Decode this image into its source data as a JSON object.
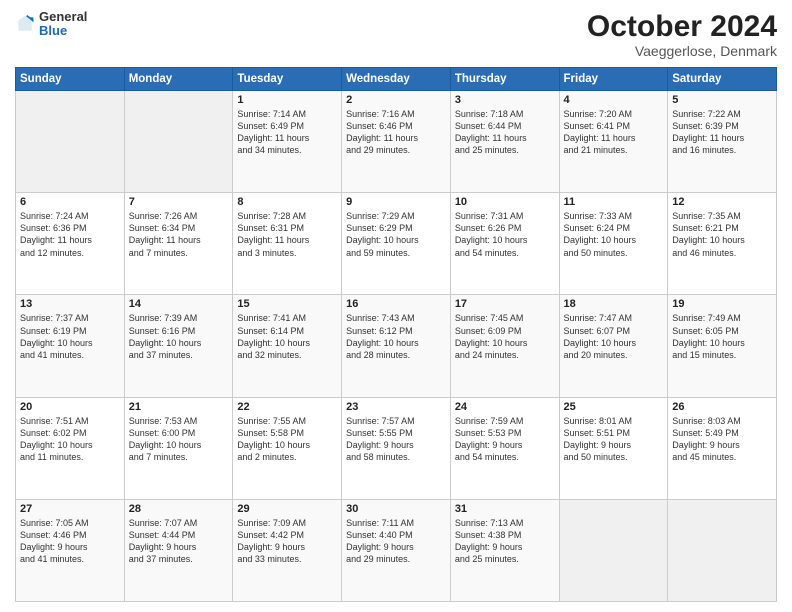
{
  "header": {
    "logo_line1": "General",
    "logo_line2": "Blue",
    "title": "October 2024",
    "subtitle": "Vaeggerlose, Denmark"
  },
  "days_of_week": [
    "Sunday",
    "Monday",
    "Tuesday",
    "Wednesday",
    "Thursday",
    "Friday",
    "Saturday"
  ],
  "weeks": [
    [
      {
        "day": "",
        "info": ""
      },
      {
        "day": "",
        "info": ""
      },
      {
        "day": "1",
        "info": "Sunrise: 7:14 AM\nSunset: 6:49 PM\nDaylight: 11 hours\nand 34 minutes."
      },
      {
        "day": "2",
        "info": "Sunrise: 7:16 AM\nSunset: 6:46 PM\nDaylight: 11 hours\nand 29 minutes."
      },
      {
        "day": "3",
        "info": "Sunrise: 7:18 AM\nSunset: 6:44 PM\nDaylight: 11 hours\nand 25 minutes."
      },
      {
        "day": "4",
        "info": "Sunrise: 7:20 AM\nSunset: 6:41 PM\nDaylight: 11 hours\nand 21 minutes."
      },
      {
        "day": "5",
        "info": "Sunrise: 7:22 AM\nSunset: 6:39 PM\nDaylight: 11 hours\nand 16 minutes."
      }
    ],
    [
      {
        "day": "6",
        "info": "Sunrise: 7:24 AM\nSunset: 6:36 PM\nDaylight: 11 hours\nand 12 minutes."
      },
      {
        "day": "7",
        "info": "Sunrise: 7:26 AM\nSunset: 6:34 PM\nDaylight: 11 hours\nand 7 minutes."
      },
      {
        "day": "8",
        "info": "Sunrise: 7:28 AM\nSunset: 6:31 PM\nDaylight: 11 hours\nand 3 minutes."
      },
      {
        "day": "9",
        "info": "Sunrise: 7:29 AM\nSunset: 6:29 PM\nDaylight: 10 hours\nand 59 minutes."
      },
      {
        "day": "10",
        "info": "Sunrise: 7:31 AM\nSunset: 6:26 PM\nDaylight: 10 hours\nand 54 minutes."
      },
      {
        "day": "11",
        "info": "Sunrise: 7:33 AM\nSunset: 6:24 PM\nDaylight: 10 hours\nand 50 minutes."
      },
      {
        "day": "12",
        "info": "Sunrise: 7:35 AM\nSunset: 6:21 PM\nDaylight: 10 hours\nand 46 minutes."
      }
    ],
    [
      {
        "day": "13",
        "info": "Sunrise: 7:37 AM\nSunset: 6:19 PM\nDaylight: 10 hours\nand 41 minutes."
      },
      {
        "day": "14",
        "info": "Sunrise: 7:39 AM\nSunset: 6:16 PM\nDaylight: 10 hours\nand 37 minutes."
      },
      {
        "day": "15",
        "info": "Sunrise: 7:41 AM\nSunset: 6:14 PM\nDaylight: 10 hours\nand 32 minutes."
      },
      {
        "day": "16",
        "info": "Sunrise: 7:43 AM\nSunset: 6:12 PM\nDaylight: 10 hours\nand 28 minutes."
      },
      {
        "day": "17",
        "info": "Sunrise: 7:45 AM\nSunset: 6:09 PM\nDaylight: 10 hours\nand 24 minutes."
      },
      {
        "day": "18",
        "info": "Sunrise: 7:47 AM\nSunset: 6:07 PM\nDaylight: 10 hours\nand 20 minutes."
      },
      {
        "day": "19",
        "info": "Sunrise: 7:49 AM\nSunset: 6:05 PM\nDaylight: 10 hours\nand 15 minutes."
      }
    ],
    [
      {
        "day": "20",
        "info": "Sunrise: 7:51 AM\nSunset: 6:02 PM\nDaylight: 10 hours\nand 11 minutes."
      },
      {
        "day": "21",
        "info": "Sunrise: 7:53 AM\nSunset: 6:00 PM\nDaylight: 10 hours\nand 7 minutes."
      },
      {
        "day": "22",
        "info": "Sunrise: 7:55 AM\nSunset: 5:58 PM\nDaylight: 10 hours\nand 2 minutes."
      },
      {
        "day": "23",
        "info": "Sunrise: 7:57 AM\nSunset: 5:55 PM\nDaylight: 9 hours\nand 58 minutes."
      },
      {
        "day": "24",
        "info": "Sunrise: 7:59 AM\nSunset: 5:53 PM\nDaylight: 9 hours\nand 54 minutes."
      },
      {
        "day": "25",
        "info": "Sunrise: 8:01 AM\nSunset: 5:51 PM\nDaylight: 9 hours\nand 50 minutes."
      },
      {
        "day": "26",
        "info": "Sunrise: 8:03 AM\nSunset: 5:49 PM\nDaylight: 9 hours\nand 45 minutes."
      }
    ],
    [
      {
        "day": "27",
        "info": "Sunrise: 7:05 AM\nSunset: 4:46 PM\nDaylight: 9 hours\nand 41 minutes."
      },
      {
        "day": "28",
        "info": "Sunrise: 7:07 AM\nSunset: 4:44 PM\nDaylight: 9 hours\nand 37 minutes."
      },
      {
        "day": "29",
        "info": "Sunrise: 7:09 AM\nSunset: 4:42 PM\nDaylight: 9 hours\nand 33 minutes."
      },
      {
        "day": "30",
        "info": "Sunrise: 7:11 AM\nSunset: 4:40 PM\nDaylight: 9 hours\nand 29 minutes."
      },
      {
        "day": "31",
        "info": "Sunrise: 7:13 AM\nSunset: 4:38 PM\nDaylight: 9 hours\nand 25 minutes."
      },
      {
        "day": "",
        "info": ""
      },
      {
        "day": "",
        "info": ""
      }
    ]
  ]
}
